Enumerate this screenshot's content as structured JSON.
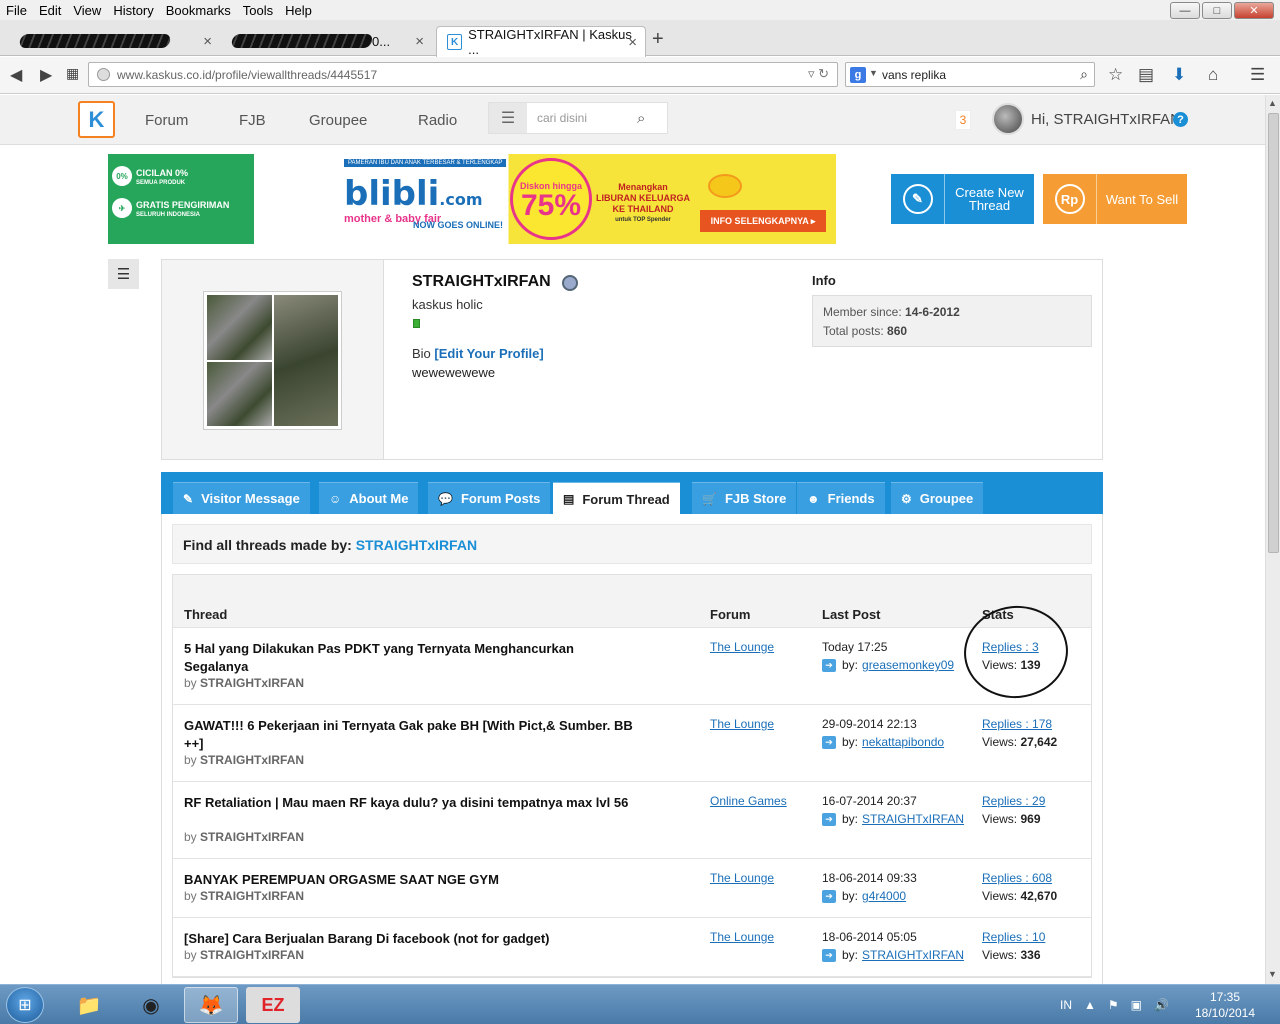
{
  "browser": {
    "menu": [
      "File",
      "Edit",
      "View",
      "History",
      "Bookmarks",
      "Tools",
      "Help"
    ],
    "window_controls": {
      "minimize": "—",
      "maximize": "□",
      "close": "✕"
    },
    "tabs": [
      {
        "title": "",
        "redacted": true
      },
      {
        "title": "0...",
        "redacted": true
      },
      {
        "title": "STRAIGHTxIRFAN | Kaskus ...",
        "active": true
      }
    ],
    "new_tab": "+",
    "url": "www.kaskus.co.id/profile/viewallthreads/4445517",
    "search_query": "vans replika",
    "search_engine_letter": "g"
  },
  "site": {
    "logo_letter": "K",
    "nav": [
      "Forum",
      "FJB",
      "Groupee",
      "Radio"
    ],
    "search_placeholder": "cari disini",
    "notification_count": "3",
    "greeting": "Hi, STRAIGHTxIRFAN",
    "help": "?"
  },
  "banner": {
    "cicilan": "CICILAN 0%",
    "cicilan_sub": "SEMUA PRODUK",
    "gratis": "GRATIS PENGIRIMAN",
    "gratis_sub": "SELURUH INDONESIA",
    "top_text": "PAMERAN IBU DAN ANAK TERBESAR & TERLENGKAP",
    "brand": "blibli",
    "brand_suffix": ".com",
    "fair": "mother & baby fair",
    "now": "NOW GOES ONLINE!",
    "discount_label": "Diskon hingga",
    "discount_value": "75%",
    "win_line1": "Menangkan",
    "win_line2": "LIBURAN KELUARGA",
    "win_line3": "KE THAILAND",
    "win_line4": "untuk TOP Spender",
    "info_btn": "INFO SELENGKAPNYA ▸"
  },
  "actions": {
    "create_label_1": "Create New",
    "create_label_2": "Thread",
    "sell_label": "Want To Sell",
    "sell_icon": "Rp"
  },
  "profile": {
    "username": "STRAIGHTxIRFAN",
    "rank": "kaskus holic",
    "bio_label": "Bio",
    "bio_edit": "[Edit Your Profile]",
    "bio_text": "wewewewewe",
    "info_title": "Info",
    "member_since_label": "Member since:",
    "member_since": "14-6-2012",
    "total_posts_label": "Total posts:",
    "total_posts": "860"
  },
  "profile_tabs": [
    {
      "label": "Visitor Message",
      "icon": "✎"
    },
    {
      "label": "About Me",
      "icon": "☺"
    },
    {
      "label": "Forum Posts",
      "icon": "💬"
    },
    {
      "label": "Forum Thread",
      "icon": "▤",
      "active": true
    },
    {
      "label": "FJB Store",
      "icon": "🛒"
    },
    {
      "label": "Friends",
      "icon": "☻"
    },
    {
      "label": "Groupee",
      "icon": "⚙"
    }
  ],
  "find": {
    "prefix": "Find all threads made by:",
    "user": "STRAIGHTxIRFAN"
  },
  "table": {
    "headers": {
      "thread": "Thread",
      "forum": "Forum",
      "last_post": "Last Post",
      "stats": "Stats"
    },
    "rows": [
      {
        "title": "5 Hal yang Dilakukan Pas PDKT yang Ternyata Menghancurkan Segalanya",
        "by": "by",
        "author": "STRAIGHTxIRFAN",
        "forum": "The Lounge",
        "last_post_time": "Today 17:25",
        "last_by_label": "by:",
        "last_by": "greasemonkey09",
        "replies": "Replies : 3",
        "views_label": "Views:",
        "views": "139"
      },
      {
        "title": "GAWAT!!! 6 Pekerjaan ini Ternyata Gak pake BH [With Pict,& Sumber. BB ++]",
        "by": "by",
        "author": "STRAIGHTxIRFAN",
        "forum": "The Lounge",
        "last_post_time": "29-09-2014 22:13",
        "last_by_label": "by:",
        "last_by": "nekattapibondo",
        "replies": "Replies : 178",
        "views_label": "Views:",
        "views": "27,642"
      },
      {
        "title": "RF Retaliation | Mau maen RF kaya dulu? ya disini tempatnya max lvl 56",
        "by": "by",
        "author": "STRAIGHTxIRFAN",
        "forum": "Online Games",
        "last_post_time": "16-07-2014 20:37",
        "last_by_label": "by:",
        "last_by": "STRAIGHTxIRFAN",
        "replies": "Replies : 29",
        "views_label": "Views:",
        "views": "969"
      },
      {
        "title": "BANYAK PEREMPUAN ORGASME SAAT NGE GYM",
        "by": "by",
        "author": "STRAIGHTxIRFAN",
        "forum": "The Lounge",
        "last_post_time": "18-06-2014 09:33",
        "last_by_label": "by:",
        "last_by": "g4r4000",
        "replies": "Replies : 608",
        "views_label": "Views:",
        "views": "42,670"
      },
      {
        "title": "[Share] Cara Berjualan Barang Di facebook (not for gadget)",
        "by": "by",
        "author": "STRAIGHTxIRFAN",
        "forum": "The Lounge",
        "last_post_time": "18-06-2014 05:05",
        "last_by_label": "by:",
        "last_by": "STRAIGHTxIRFAN",
        "replies": "Replies : 10",
        "views_label": "Views:",
        "views": "336"
      }
    ]
  },
  "taskbar": {
    "lang": "IN",
    "time": "17:35",
    "date": "18/10/2014",
    "apps": [
      "explorer-icon",
      "chrome-icon",
      "firefox-icon",
      "ez-icon"
    ],
    "ez_label": "EZ"
  },
  "colors": {
    "accent": "#1b8fd6",
    "orange": "#f58220",
    "link": "#1b6fb8"
  }
}
